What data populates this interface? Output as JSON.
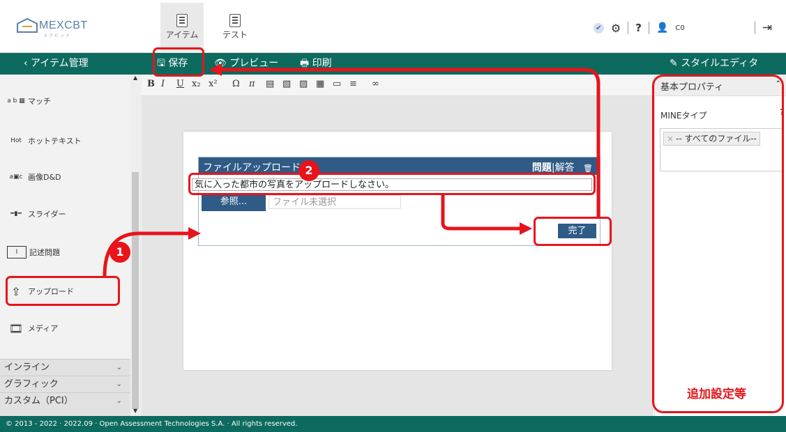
{
  "app": {
    "logo_text": "MEXCBT",
    "logo_sub": "メクビット"
  },
  "top_tabs": [
    {
      "label": "アイテム",
      "active": true
    },
    {
      "label": "テスト",
      "active": false
    }
  ],
  "top_right": {
    "help": "?",
    "user": "C0",
    "logout_icon": "logout-icon"
  },
  "navbar": {
    "back_label": "‹ アイテム管理",
    "save_label": "保存",
    "preview_label": "プレビュー",
    "print_label": "印刷",
    "style_editor_label": "スタイルエディタ"
  },
  "sidebar": {
    "items": [
      {
        "label": "マッチ",
        "icon": "match-icon"
      },
      {
        "label": "ホットテキスト",
        "icon": "hottext-icon"
      },
      {
        "label": "画像D&D",
        "icon": "image-dnd-icon"
      },
      {
        "label": "スライダー",
        "icon": "slider-icon"
      },
      {
        "label": "記述問題",
        "icon": "text-entry-icon"
      },
      {
        "label": "アップロード",
        "icon": "upload-icon"
      },
      {
        "label": "メディア",
        "icon": "media-icon"
      }
    ],
    "groups": [
      {
        "label": "インライン"
      },
      {
        "label": "グラフィック"
      },
      {
        "label": "カスタム（PCI）"
      }
    ]
  },
  "toolbar": {
    "buttons": [
      "B",
      "I",
      "U",
      "x₂",
      "x²",
      "Ω",
      "π"
    ]
  },
  "editor": {
    "widget_title": "ファイルアップロード",
    "tab_question": "問題",
    "tab_sep": "|",
    "tab_answer": "解答",
    "prompt": "気に入った都市の写真をアップロードしなさい。",
    "browse_label": "参照...",
    "file_placeholder": "ファイル未選択",
    "done_label": "完了"
  },
  "right_panel": {
    "header": "基本プロパティ",
    "mine_label": "MINEタイプ",
    "mine_help": "?",
    "mine_tag": "-- すべてのファイル--"
  },
  "annotations": {
    "badge1": "1",
    "badge2": "2",
    "extra_settings": "追加設定等",
    "color": "#e8141b"
  },
  "footer": {
    "text": "© 2013 - 2022 · 2022.09 · Open Assessment Technologies S.A. · All rights reserved."
  }
}
